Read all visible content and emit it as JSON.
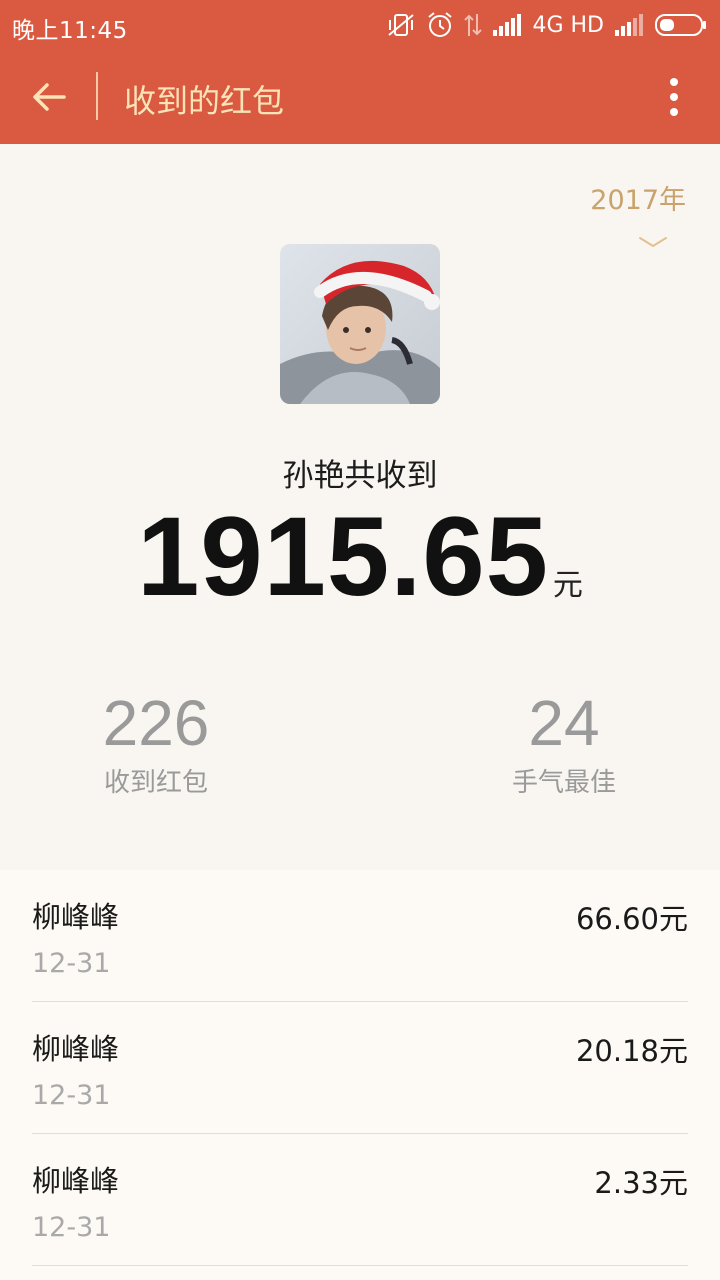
{
  "status_bar": {
    "time": "晚上11:45",
    "network": "4G HD",
    "icons": [
      "vibrate-off-icon",
      "alarm-icon",
      "data-arrows-icon",
      "signal-icon",
      "signal-icon",
      "battery-icon"
    ]
  },
  "app_bar": {
    "title": "收到的红包",
    "back_icon": "arrow-left-icon",
    "menu_icon": "more-vertical-icon"
  },
  "year_filter": {
    "selected": "2017年"
  },
  "summary": {
    "owner_text": "孙艳共收到",
    "total": "1915.65",
    "unit": "元",
    "received_count": "226",
    "received_label": "收到红包",
    "best_luck_count": "24",
    "best_luck_label": "手气最佳"
  },
  "records": [
    {
      "name": "柳峰峰",
      "date": "12-31",
      "amount": "66.60元"
    },
    {
      "name": "柳峰峰",
      "date": "12-31",
      "amount": "20.18元"
    },
    {
      "name": "柳峰峰",
      "date": "12-31",
      "amount": "2.33元"
    }
  ],
  "colors": {
    "header": "#d95a40",
    "title_text": "#fbe3b8",
    "year_accent": "#c9a36b",
    "background": "#f9f6f1"
  }
}
